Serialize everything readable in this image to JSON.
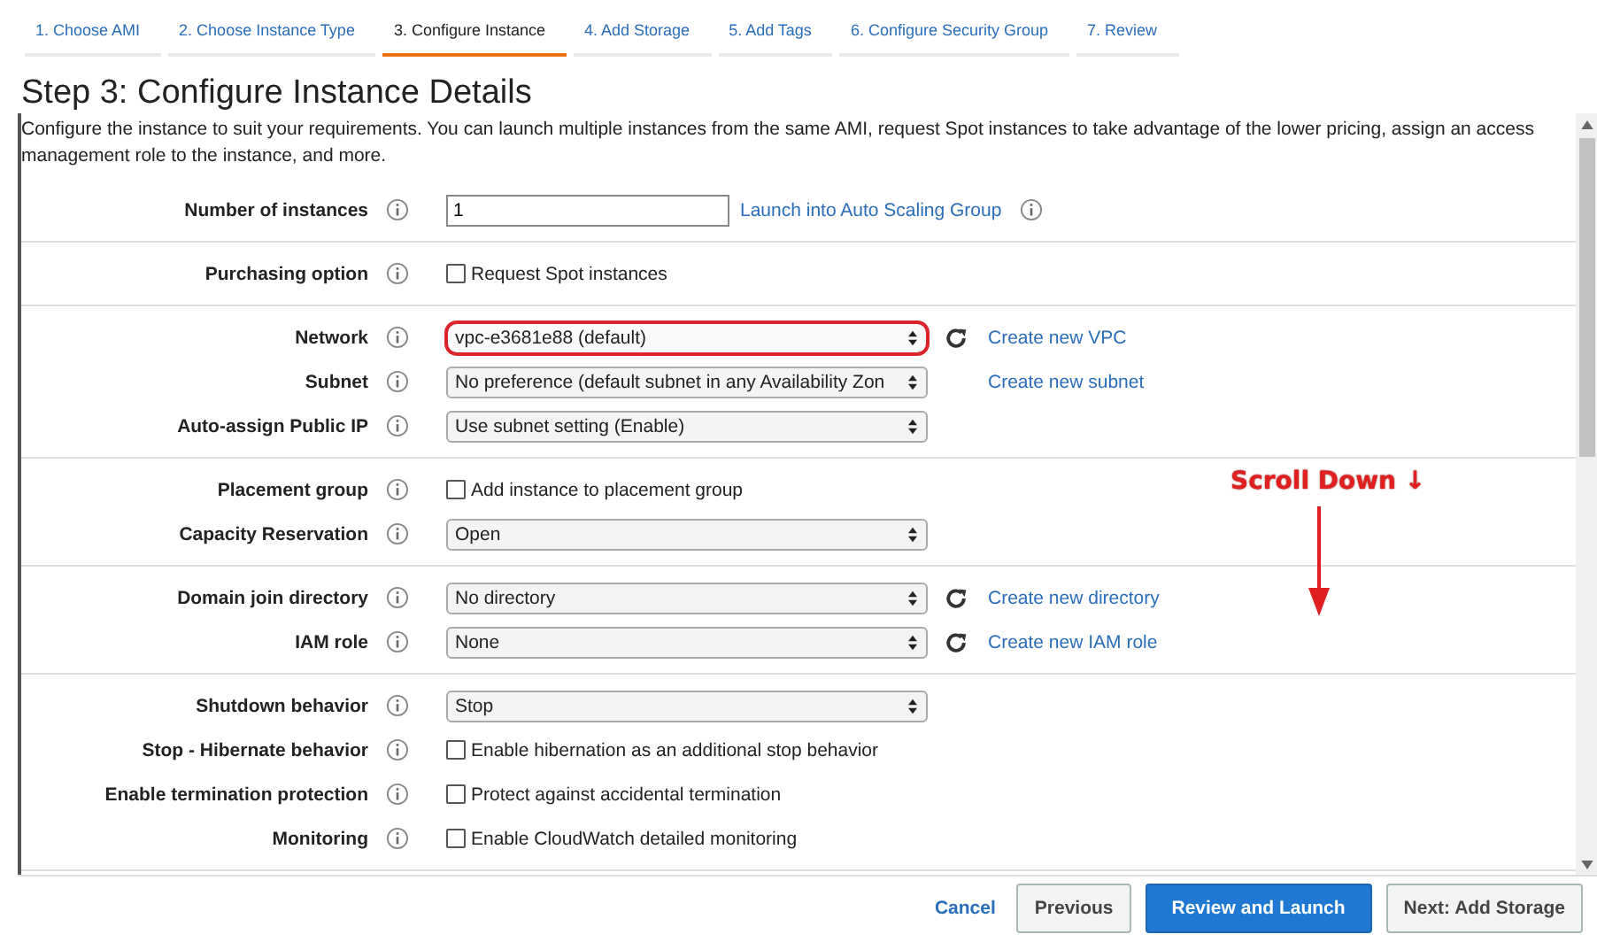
{
  "tabs": [
    {
      "label": "1. Choose AMI",
      "selected": false
    },
    {
      "label": "2. Choose Instance Type",
      "selected": false
    },
    {
      "label": "3. Configure Instance",
      "selected": true
    },
    {
      "label": "4. Add Storage",
      "selected": false
    },
    {
      "label": "5. Add Tags",
      "selected": false
    },
    {
      "label": "6. Configure Security Group",
      "selected": false
    },
    {
      "label": "7. Review",
      "selected": false
    }
  ],
  "heading": "Step 3: Configure Instance Details",
  "description": "Configure the instance to suit your requirements. You can launch multiple instances from the same AMI, request Spot instances to take advantage of the lower pricing, assign an access management role to the instance, and more.",
  "groups": [
    {
      "rows": [
        {
          "label": "Number of instances",
          "kind": "input",
          "value": "1",
          "link": "Launch into Auto Scaling Group",
          "link_info": true
        }
      ]
    },
    {
      "rows": [
        {
          "label": "Purchasing option",
          "kind": "checkbox",
          "text": "Request Spot instances",
          "checked": false
        }
      ]
    },
    {
      "rows": [
        {
          "label": "Network",
          "kind": "select",
          "value": "vpc-e3681e88 (default)",
          "highlighted": true,
          "refresh": true,
          "link": "Create new VPC"
        },
        {
          "label": "Subnet",
          "kind": "select",
          "value": "No preference (default subnet in any Availability Zon",
          "highlighted": false,
          "refresh": false,
          "link": "Create new subnet"
        },
        {
          "label": "Auto-assign Public IP",
          "kind": "select",
          "value": "Use subnet setting (Enable)",
          "highlighted": false,
          "refresh": false
        }
      ]
    },
    {
      "rows": [
        {
          "label": "Placement group",
          "kind": "checkbox",
          "text": "Add instance to placement group",
          "checked": false
        },
        {
          "label": "Capacity Reservation",
          "kind": "select",
          "value": "Open",
          "highlighted": false,
          "refresh": false
        }
      ]
    },
    {
      "rows": [
        {
          "label": "Domain join directory",
          "kind": "select",
          "value": "No directory",
          "highlighted": false,
          "refresh": true,
          "link": "Create new directory"
        },
        {
          "label": "IAM role",
          "kind": "select",
          "value": "None",
          "highlighted": false,
          "refresh": true,
          "link": "Create new IAM role"
        }
      ]
    },
    {
      "rows": [
        {
          "label": "Shutdown behavior",
          "kind": "select",
          "value": "Stop",
          "highlighted": false,
          "refresh": false
        },
        {
          "label": "Stop - Hibernate behavior",
          "kind": "checkbox",
          "text": "Enable hibernation as an additional stop behavior",
          "checked": false
        },
        {
          "label": "Enable termination protection",
          "kind": "checkbox",
          "text": "Protect against accidental termination",
          "checked": false
        },
        {
          "label": "Monitoring",
          "kind": "checkbox",
          "text": "Enable CloudWatch detailed monitoring",
          "checked": false
        }
      ]
    }
  ],
  "annotation": "Scroll Down ↓",
  "buttons": [
    {
      "label": "Cancel",
      "kind": "link"
    },
    {
      "label": "Previous",
      "kind": "secondary"
    },
    {
      "label": "Review and Launch",
      "kind": "primary"
    },
    {
      "label": "Next: Add Storage",
      "kind": "secondary"
    }
  ]
}
